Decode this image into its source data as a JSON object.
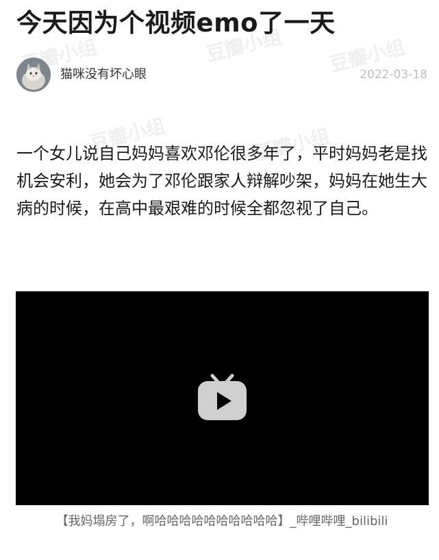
{
  "post": {
    "title": "今天因为个视频emo了一天",
    "author": "猫咪没有坏心眼",
    "date": "2022-03-18",
    "body": "一个女儿说自己妈妈喜欢邓伦很多年了，平时妈妈老是找机会安利，她会为了邓伦跟家人辩解吵架，妈妈在她生大病的时候，在高中最艰难的时候全都忽视了自己。"
  },
  "video": {
    "caption": "【我妈塌房了，啊哈哈哈哈哈哈哈哈哈哈】_哔哩哔哩_bilibili",
    "icon": "bilibili-tv-play-icon"
  },
  "watermarks": [
    "豆瓣小组",
    "豆瓣小组",
    "豆瓣小组",
    "豆瓣小组",
    "豆瓣小组"
  ],
  "colors": {
    "video_bg": "#000000",
    "date": "#bdbdbd",
    "caption": "#666666"
  }
}
